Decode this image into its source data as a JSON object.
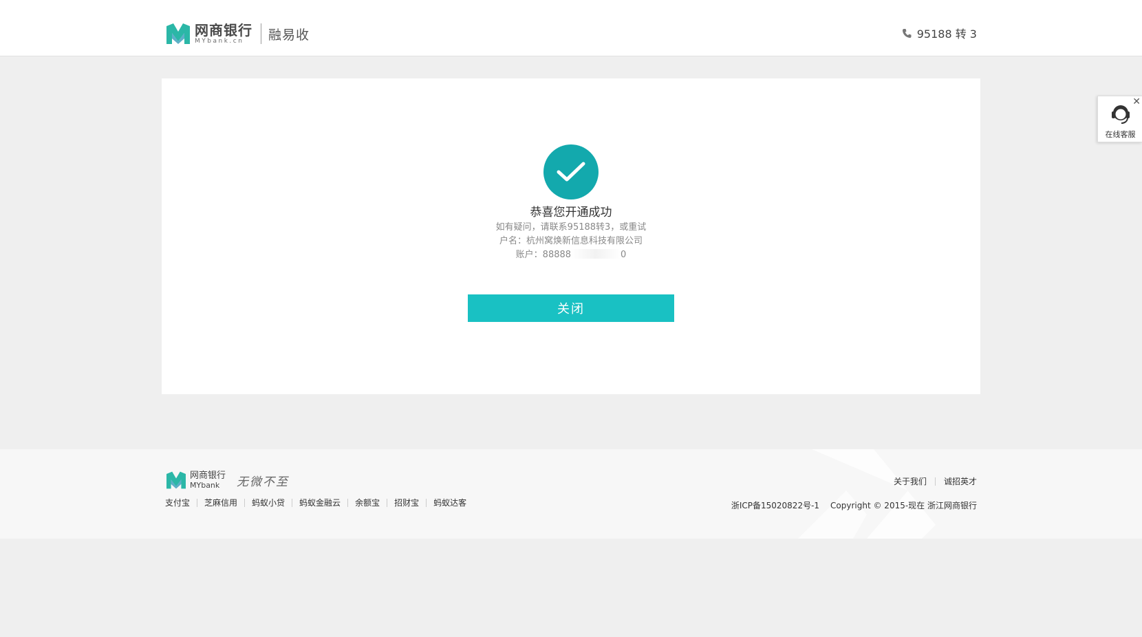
{
  "header": {
    "logo_cn": "网商银行",
    "logo_en": "MYbank.cn",
    "product": "融易收",
    "phone": "95188 转 3"
  },
  "result": {
    "title": "恭喜您开通成功",
    "help_text": "如有疑问，请联系95188转3，或重试",
    "account_name": "户名：杭州窝焕新信息科技有限公司",
    "account_prefix": "账户：88888",
    "account_suffix": "0",
    "close_label": "关闭"
  },
  "side_widget": {
    "label": "在线客服",
    "close": "✕"
  },
  "footer": {
    "logo_cn": "网商银行",
    "logo_en": "MYbank",
    "slogan": "无微不至",
    "links": [
      "支付宝",
      "芝麻信用",
      "蚂蚁小贷",
      "蚂蚁金融云",
      "余额宝",
      "招财宝",
      "蚂蚁达客"
    ],
    "right_links": [
      "关于我们",
      "诚招英才"
    ],
    "icp": "浙ICP备15020822号-1",
    "copyright": "Copyright © 2015-现在 浙江网商银行"
  },
  "colors": {
    "accent": "#13a9ad",
    "button": "#19c1c3"
  }
}
